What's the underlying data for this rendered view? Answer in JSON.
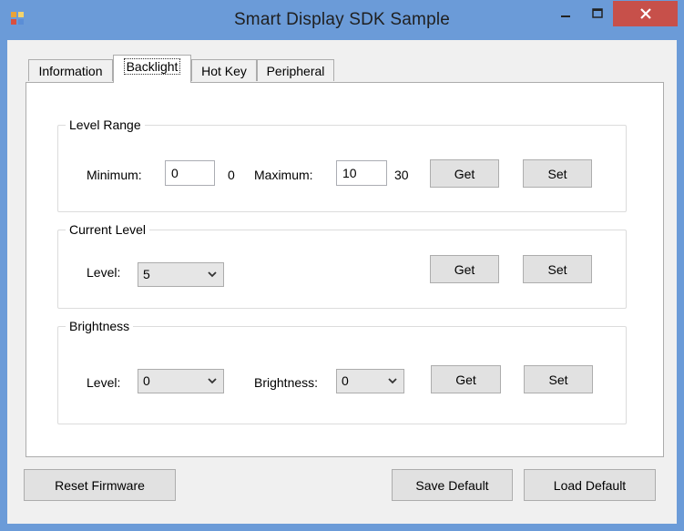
{
  "window": {
    "title": "Smart Display SDK Sample",
    "titlebar_bg": "#6b9bd8",
    "close_button_color": "#c7504a"
  },
  "tabs": [
    {
      "label": "Information",
      "active": false
    },
    {
      "label": "Backlight",
      "active": true
    },
    {
      "label": "Hot Key",
      "active": false
    },
    {
      "label": "Peripheral",
      "active": false
    }
  ],
  "level_range": {
    "title": "Level Range",
    "minimum_label": "Minimum:",
    "minimum_value": "0",
    "minimum_readout": "0",
    "maximum_label": "Maximum:",
    "maximum_value": "10",
    "maximum_readout": "30",
    "get_label": "Get",
    "set_label": "Set"
  },
  "current_level": {
    "title": "Current Level",
    "level_label": "Level:",
    "level_value": "5",
    "get_label": "Get",
    "set_label": "Set"
  },
  "brightness": {
    "title": "Brightness",
    "level_label": "Level:",
    "level_value": "0",
    "brightness_label": "Brightness:",
    "brightness_value": "0",
    "get_label": "Get",
    "set_label": "Set"
  },
  "footer": {
    "reset_firmware_label": "Reset Firmware",
    "save_default_label": "Save Default",
    "load_default_label": "Load Default"
  }
}
